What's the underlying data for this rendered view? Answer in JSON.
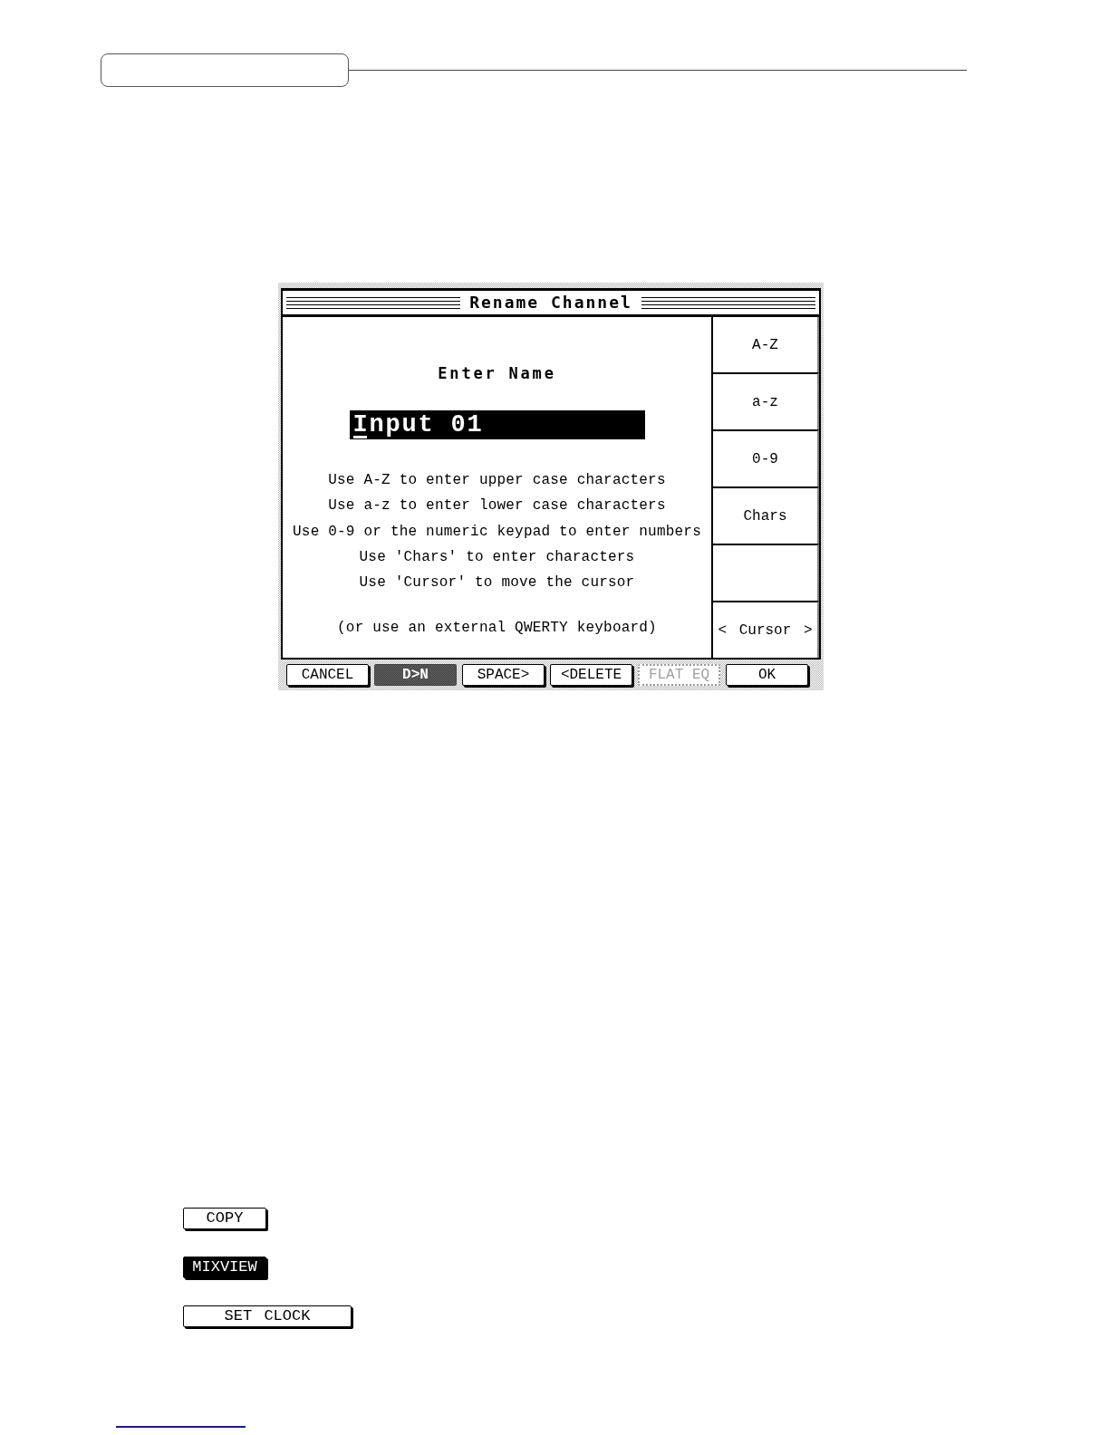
{
  "dialog": {
    "title": "Rename Channel",
    "prompt": "Enter Name",
    "name_field": {
      "value": "Input 01"
    },
    "instructions": [
      "Use A-Z to enter upper case characters",
      "Use a-z to enter lower case characters",
      "Use 0-9 or the numeric keypad to enter numbers",
      "Use 'Chars' to enter characters",
      "Use 'Cursor' to move the cursor"
    ],
    "note": "(or use an external QWERTY keyboard)",
    "side_keys": [
      {
        "kind": "key",
        "label": "A-Z"
      },
      {
        "kind": "key",
        "label": "a-z"
      },
      {
        "kind": "key",
        "label": "0-9"
      },
      {
        "kind": "key",
        "label": "Chars"
      },
      {
        "kind": "empty"
      },
      {
        "kind": "key",
        "label": "< Cursor >"
      }
    ],
    "buttons": [
      {
        "label": "CANCEL",
        "kind": "plain",
        "disabled": false
      },
      {
        "label": "D>N",
        "kind": "shaded",
        "disabled": true
      },
      {
        "label": "SPACE>",
        "kind": "plain",
        "disabled": false
      },
      {
        "label": "<DELETE",
        "kind": "plain",
        "disabled": false
      },
      {
        "label": "FLAT EQ",
        "kind": "dotted",
        "disabled": true
      },
      {
        "label": "OK",
        "kind": "plain",
        "disabled": false
      }
    ]
  },
  "examples": [
    {
      "label": "COPY",
      "kind": "single",
      "selected": false
    },
    {
      "label": "MIXVIEW",
      "kind": "single",
      "selected": true
    },
    {
      "label": "SET CLOCK",
      "kind": "double",
      "selected": false
    }
  ]
}
